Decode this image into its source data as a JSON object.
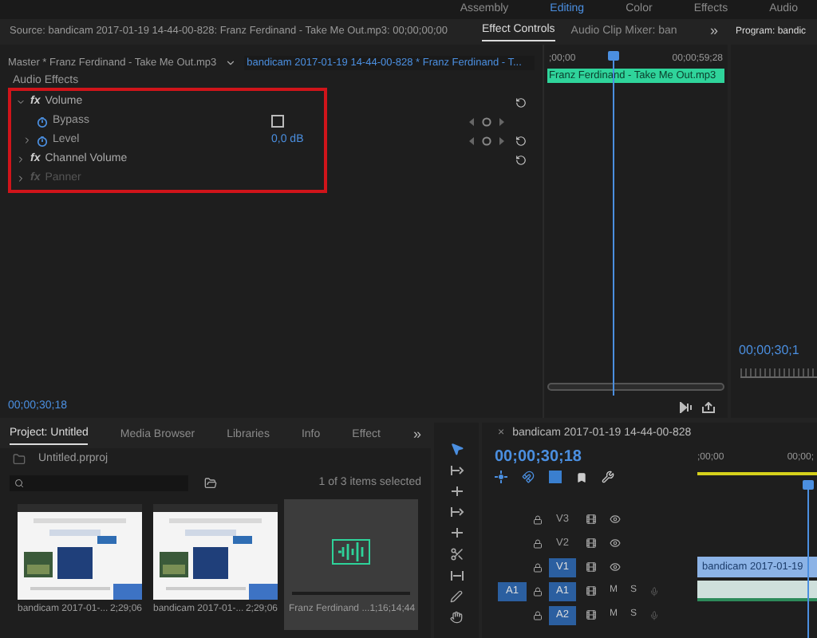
{
  "workspaces": [
    {
      "label": "Assembly",
      "selected": false
    },
    {
      "label": "Editing",
      "selected": true
    },
    {
      "label": "Color",
      "selected": false
    },
    {
      "label": "Effects",
      "selected": false
    },
    {
      "label": "Audio",
      "selected": false
    }
  ],
  "source_tab": {
    "label": "Source: bandicam 2017-01-19 14-44-00-828: Franz Ferdinand - Take Me Out.mp3: 00;00;00;00"
  },
  "panel_tabs": [
    {
      "label": "Effect Controls",
      "selected": true
    },
    {
      "label": "Audio Clip Mixer: ban",
      "selected": false
    }
  ],
  "more_tabs": "»",
  "effect_controls": {
    "master": "Master * Franz Ferdinand - Take Me Out.mp3",
    "clip": "bandicam 2017-01-19 14-44-00-828 * Franz Ferdinand - T...",
    "section": "Audio Effects",
    "effects": [
      {
        "badge": "fx",
        "name": "Volume",
        "expanded": true,
        "disabled": false,
        "params": [
          {
            "kind": "checkbox",
            "name": "Bypass",
            "checked": false
          },
          {
            "kind": "value",
            "name": "Level",
            "value": "0,0 dB"
          }
        ]
      },
      {
        "badge": "fx",
        "name": "Channel Volume",
        "expanded": false,
        "disabled": false
      },
      {
        "badge": "fx",
        "name": "Panner",
        "expanded": false,
        "disabled": true
      }
    ],
    "timecode": "00;00;30;18",
    "ruler_start": ";00;00",
    "ruler_end": "00;00;59;28",
    "clip_bar": "Franz Ferdinand - Take Me Out.mp3"
  },
  "program": {
    "title": "Program: bandic",
    "timecode": "00;00;30;1"
  },
  "project": {
    "tabs": [
      {
        "label": "Project: Untitled",
        "selected": true
      },
      {
        "label": "Media Browser",
        "selected": false
      },
      {
        "label": "Libraries",
        "selected": false
      },
      {
        "label": "Info",
        "selected": false
      },
      {
        "label": "Effect",
        "selected": false
      }
    ],
    "more_tabs": "»",
    "file": "Untitled.prproj",
    "status": "1 of 3 items selected",
    "items": [
      {
        "kind": "video",
        "name": "bandicam 2017-01-...",
        "duration": "2;29;06",
        "selected": false
      },
      {
        "kind": "video",
        "name": "bandicam 2017-01-...",
        "duration": "2;29;06",
        "selected": false
      },
      {
        "kind": "audio",
        "name": "Franz Ferdinand ...",
        "duration": "1;16;14;44",
        "selected": true
      }
    ]
  },
  "timeline": {
    "close": "×",
    "title": "bandicam 2017-01-19 14-44-00-828",
    "timecode": "00;00;30;18",
    "ruler_start": ";00;00",
    "ruler_end": "00;00;",
    "tracks": [
      {
        "kind": "video",
        "name": "V3",
        "selected": false
      },
      {
        "kind": "video",
        "name": "V2",
        "selected": false
      },
      {
        "kind": "video",
        "name": "V1",
        "selected": true,
        "clip": "bandicam 2017-01-19"
      },
      {
        "kind": "audio",
        "name": "A1",
        "selected": true,
        "source": "A1",
        "mute": "M",
        "solo": "S",
        "audio_clip": true
      },
      {
        "kind": "audio",
        "name": "A2",
        "selected": true,
        "mute": "M",
        "solo": "S",
        "audio_clip": false
      }
    ]
  }
}
